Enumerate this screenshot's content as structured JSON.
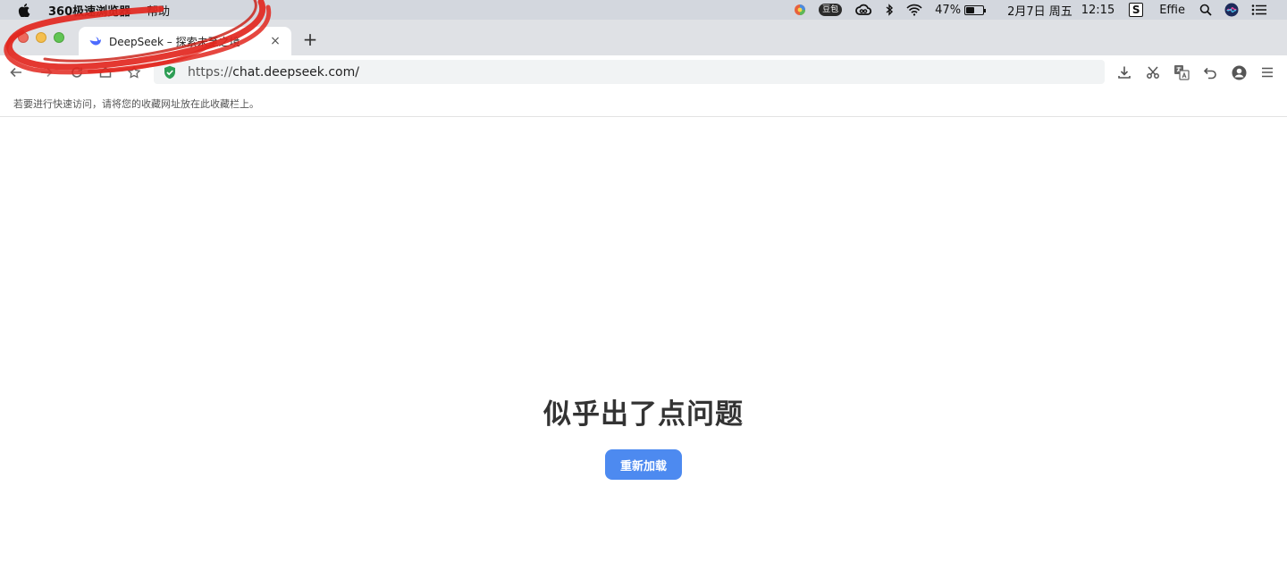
{
  "menubar": {
    "app_name": "360极速浏览器",
    "menus": [
      "帮助"
    ],
    "doubao_label": "豆包",
    "battery_percent": "47%",
    "battery_level": 0.47,
    "date": "2月7日 周五",
    "time": "12:15",
    "s_label": "S",
    "user": "Effie"
  },
  "tab": {
    "title": "DeepSeek – 探索未至之境",
    "close_glyph": "×",
    "new_tab_glyph": "+"
  },
  "toolbar": {
    "url_scheme": "https://",
    "url_host": "chat.deepseek.com/"
  },
  "bookmarks": {
    "hint": "若要进行快速访问，请将您的收藏网址放在此收藏栏上。"
  },
  "page": {
    "error_title": "似乎出了点问题",
    "reload_label": "重新加载"
  },
  "colors": {
    "accent": "#4d8af0",
    "annotation": "#e2271f",
    "secure": "#2e9e55"
  }
}
